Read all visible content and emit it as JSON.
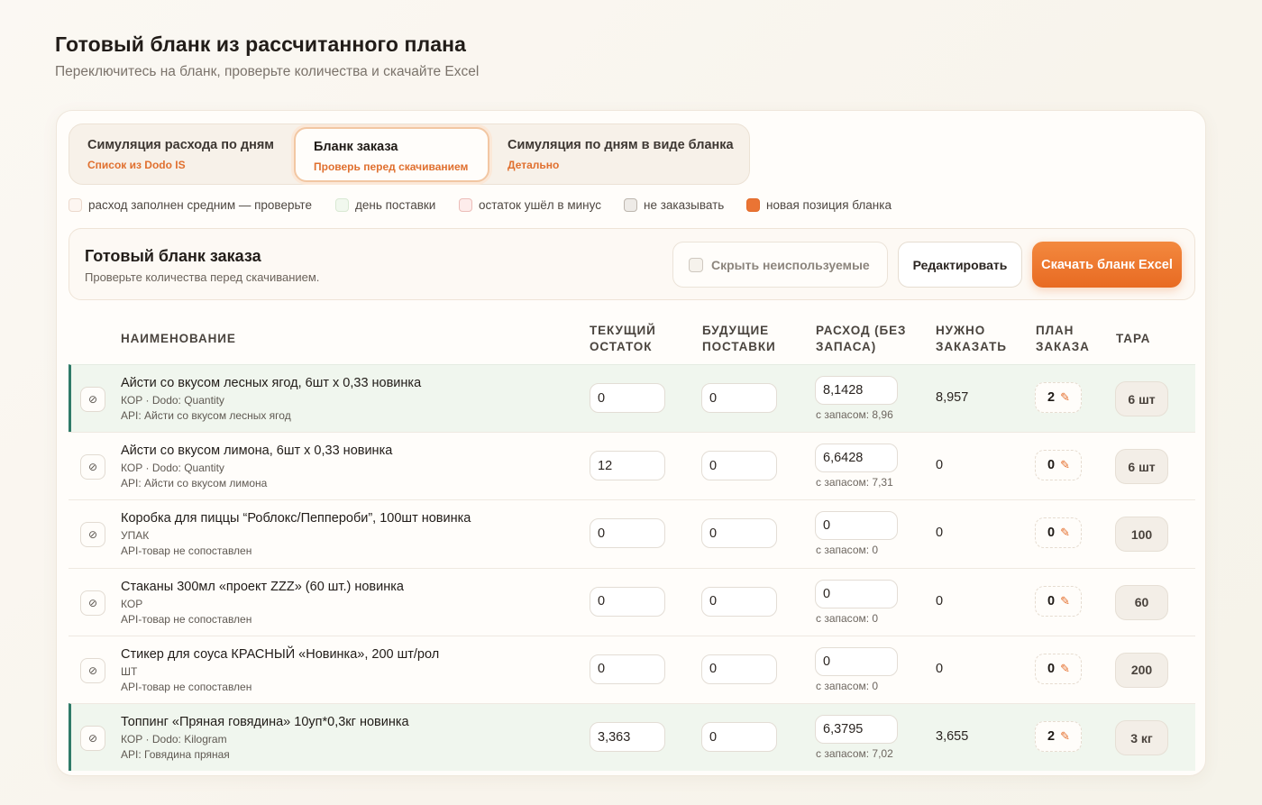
{
  "page": {
    "title": "Готовый бланк из рассчитанного плана",
    "subtitle": "Переключитесь на бланк, проверьте количества и скачайте Excel"
  },
  "tabs": [
    {
      "label": "Симуляция расхода по дням",
      "sub": "Список из Dodo IS",
      "active": false
    },
    {
      "label": "Бланк заказа",
      "sub": "Проверь перед скачиванием",
      "active": true
    },
    {
      "label": "Симуляция по дням в виде бланка",
      "sub": "Детально",
      "active": false
    }
  ],
  "legend": [
    {
      "label": "расход заполнен средним — проверьте",
      "fill": "#fdf6f1",
      "border": "#ecd9cc"
    },
    {
      "label": "день поставки",
      "fill": "#f1f8ee",
      "border": "#d9e9d3"
    },
    {
      "label": "остаток ушёл в минус",
      "fill": "#fdeceb",
      "border": "#ecbdb8"
    },
    {
      "label": "не заказывать",
      "fill": "#eeebe7",
      "border": "#bdb6ae"
    },
    {
      "label": "новая позиция бланка",
      "fill": "#ea7434",
      "border": "#e26a28"
    }
  ],
  "form": {
    "title": "Готовый бланк заказа",
    "subtitle": "Проверьте количества перед скачиванием.",
    "hide_unused_label": "Скрыть неиспользуемые",
    "hide_unused_checked": false,
    "edit_label": "Редактировать",
    "download_label": "Скачать бланк Excel"
  },
  "columns": {
    "name": "НАИМЕНОВАНИЕ",
    "current_1": "ТЕКУЩИЙ",
    "current_2": "ОСТАТОК",
    "future_1": "БУДУЩИЕ",
    "future_2": "ПОСТАВКИ",
    "rate_1": "РАСХОД (БЕЗ",
    "rate_2": "ЗАПАСА)",
    "need_1": "НУЖНО",
    "need_2": "ЗАКАЗАТЬ",
    "plan_1": "ПЛАН",
    "plan_2": "ЗАКАЗА",
    "tara": "ТАРА"
  },
  "rows": [
    {
      "name": "Айсти со вкусом лесных ягод, 6шт х 0,33 новинка",
      "meta": "КОР · Dodo: Quantity",
      "api": "API: Айсти со вкусом лесных ягод",
      "current": "0",
      "future": "0",
      "rate": "8,1428",
      "reserve": "с запасом: 8,96",
      "need": "8,957",
      "plan": "2",
      "tara": "6 шт",
      "highlight": true,
      "skip_icon": "⊘"
    },
    {
      "name": "Айсти со вкусом лимона, 6шт х 0,33 новинка",
      "meta": "КОР · Dodo: Quantity",
      "api": "API: Айсти со вкусом лимона",
      "current": "12",
      "future": "0",
      "rate": "6,6428",
      "reserve": "с запасом: 7,31",
      "need": "0",
      "plan": "0",
      "tara": "6 шт",
      "highlight": false,
      "skip_icon": "⊘"
    },
    {
      "name": "Коробка для пиццы “Роблокс/Пеппероби”, 100шт новинка",
      "meta": "УПАК",
      "api": "API-товар не сопоставлен",
      "current": "0",
      "future": "0",
      "rate": "0",
      "reserve": "с запасом: 0",
      "need": "0",
      "plan": "0",
      "tara": "100",
      "highlight": false,
      "skip_icon": "⊘"
    },
    {
      "name": "Стаканы 300мл «проект ZZZ» (60 шт.) новинка",
      "meta": "КОР",
      "api": "API-товар не сопоставлен",
      "current": "0",
      "future": "0",
      "rate": "0",
      "reserve": "с запасом: 0",
      "need": "0",
      "plan": "0",
      "tara": "60",
      "highlight": false,
      "skip_icon": "⊘"
    },
    {
      "name": "Стикер для соуса КРАСНЫЙ «Новинка», 200 шт/рол",
      "meta": "ШТ",
      "api": "API-товар не сопоставлен",
      "current": "0",
      "future": "0",
      "rate": "0",
      "reserve": "с запасом: 0",
      "need": "0",
      "plan": "0",
      "tara": "200",
      "highlight": false,
      "skip_icon": "⊘"
    },
    {
      "name": "Топпинг «Пряная говядина» 10уп*0,3кг новинка",
      "meta": "КОР · Dodo: Kilogram",
      "api": "API: Говядина пряная",
      "current": "3,363",
      "future": "0",
      "rate": "6,3795",
      "reserve": "с запасом: 7,02",
      "need": "3,655",
      "plan": "2",
      "tara": "3 кг",
      "highlight": true,
      "skip_icon": "⊘"
    }
  ],
  "icons": {
    "pencil": "✎",
    "skip": "block-icon"
  },
  "colors": {
    "accent": "#e86a22",
    "highlight_row": "#f0f6ee",
    "highlight_border": "#2f7a68"
  }
}
